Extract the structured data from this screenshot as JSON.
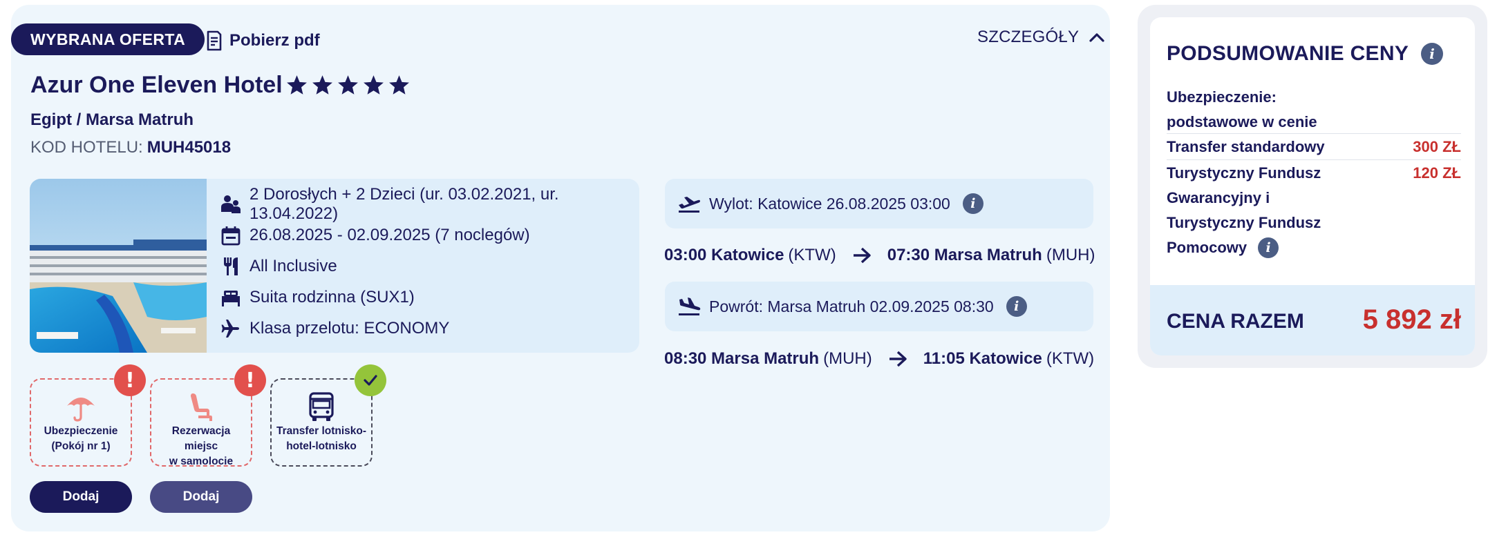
{
  "offer": {
    "badge": "WYBRANA OFERTA",
    "pdf_label": "Pobierz pdf",
    "details_label": "SZCZEGÓŁY"
  },
  "hotel": {
    "name": "Azur One Eleven Hotel",
    "stars": 5,
    "location": "Egipt / Marsa Matruh",
    "code_label": "KOD HOTELU:",
    "code": "MUH45018"
  },
  "info": {
    "guests": "2 Dorosłych + 2 Dzieci (ur. 03.02.2021, ur. 13.04.2022)",
    "dates": "26.08.2025 - 02.09.2025 (7 noclegów)",
    "board": "All Inclusive",
    "room": "Suita rodzinna (SUX1)",
    "flight_class": "Klasa przelotu: ECONOMY"
  },
  "flights": {
    "outbound": {
      "title": "Wylot: Katowice 26.08.2025 03:00",
      "dep_time_city": "03:00 Katowice",
      "dep_code": "(KTW)",
      "arr_time_city": "07:30 Marsa Matruh",
      "arr_code": "(MUH)"
    },
    "return": {
      "title": "Powrót: Marsa Matruh 02.09.2025 08:30",
      "dep_time_city": "08:30 Marsa Matruh",
      "dep_code": "(MUH)",
      "arr_time_city": "11:05 Katowice",
      "arr_code": "(KTW)"
    }
  },
  "addons": [
    {
      "label_line1": "Ubezpieczenie",
      "label_line2": "(Pokój nr 1)",
      "status": "warning",
      "status_glyph": "!"
    },
    {
      "label_line1": "Rezerwacja miejsc",
      "label_line2": "w samolocie",
      "status": "warning",
      "status_glyph": "!"
    },
    {
      "label_line1": "Transfer lotnisko-",
      "label_line2": "hotel-lotnisko",
      "status": "ok",
      "status_glyph": ""
    }
  ],
  "buttons": {
    "add_1": "Dodaj",
    "add_2": "Dodaj"
  },
  "summary": {
    "title": "PODSUMOWANIE CENY",
    "insurance_line1": "Ubezpieczenie:",
    "insurance_line2": "podstawowe w cenie",
    "transfer_label": "Transfer standardowy",
    "transfer_price": "300 ZŁ",
    "fund_line1": "Turystyczny Fundusz",
    "fund_line2": "Gwarancyjny i",
    "fund_line3": "Turystyczny Fundusz",
    "fund_line4": "Pomocowy",
    "fund_price": "120 ZŁ",
    "total_label": "CENA RAZEM",
    "total_value": "5 892 zł"
  },
  "colors": {
    "navy": "#1b1a5a",
    "price_red": "#c8302e",
    "warning_red": "#e2504c",
    "ok_green": "#94c43a",
    "panel_blue": "#dfeefa"
  },
  "icons": [
    "document-icon",
    "chevron-up-icon",
    "star-icon",
    "people-icon",
    "calendar-icon",
    "cutlery-icon",
    "bed-icon",
    "plane-icon",
    "takeoff-icon",
    "landing-icon",
    "arrow-right-icon",
    "info-icon",
    "umbrella-icon",
    "seat-icon",
    "bus-icon",
    "checkmark-icon"
  ]
}
